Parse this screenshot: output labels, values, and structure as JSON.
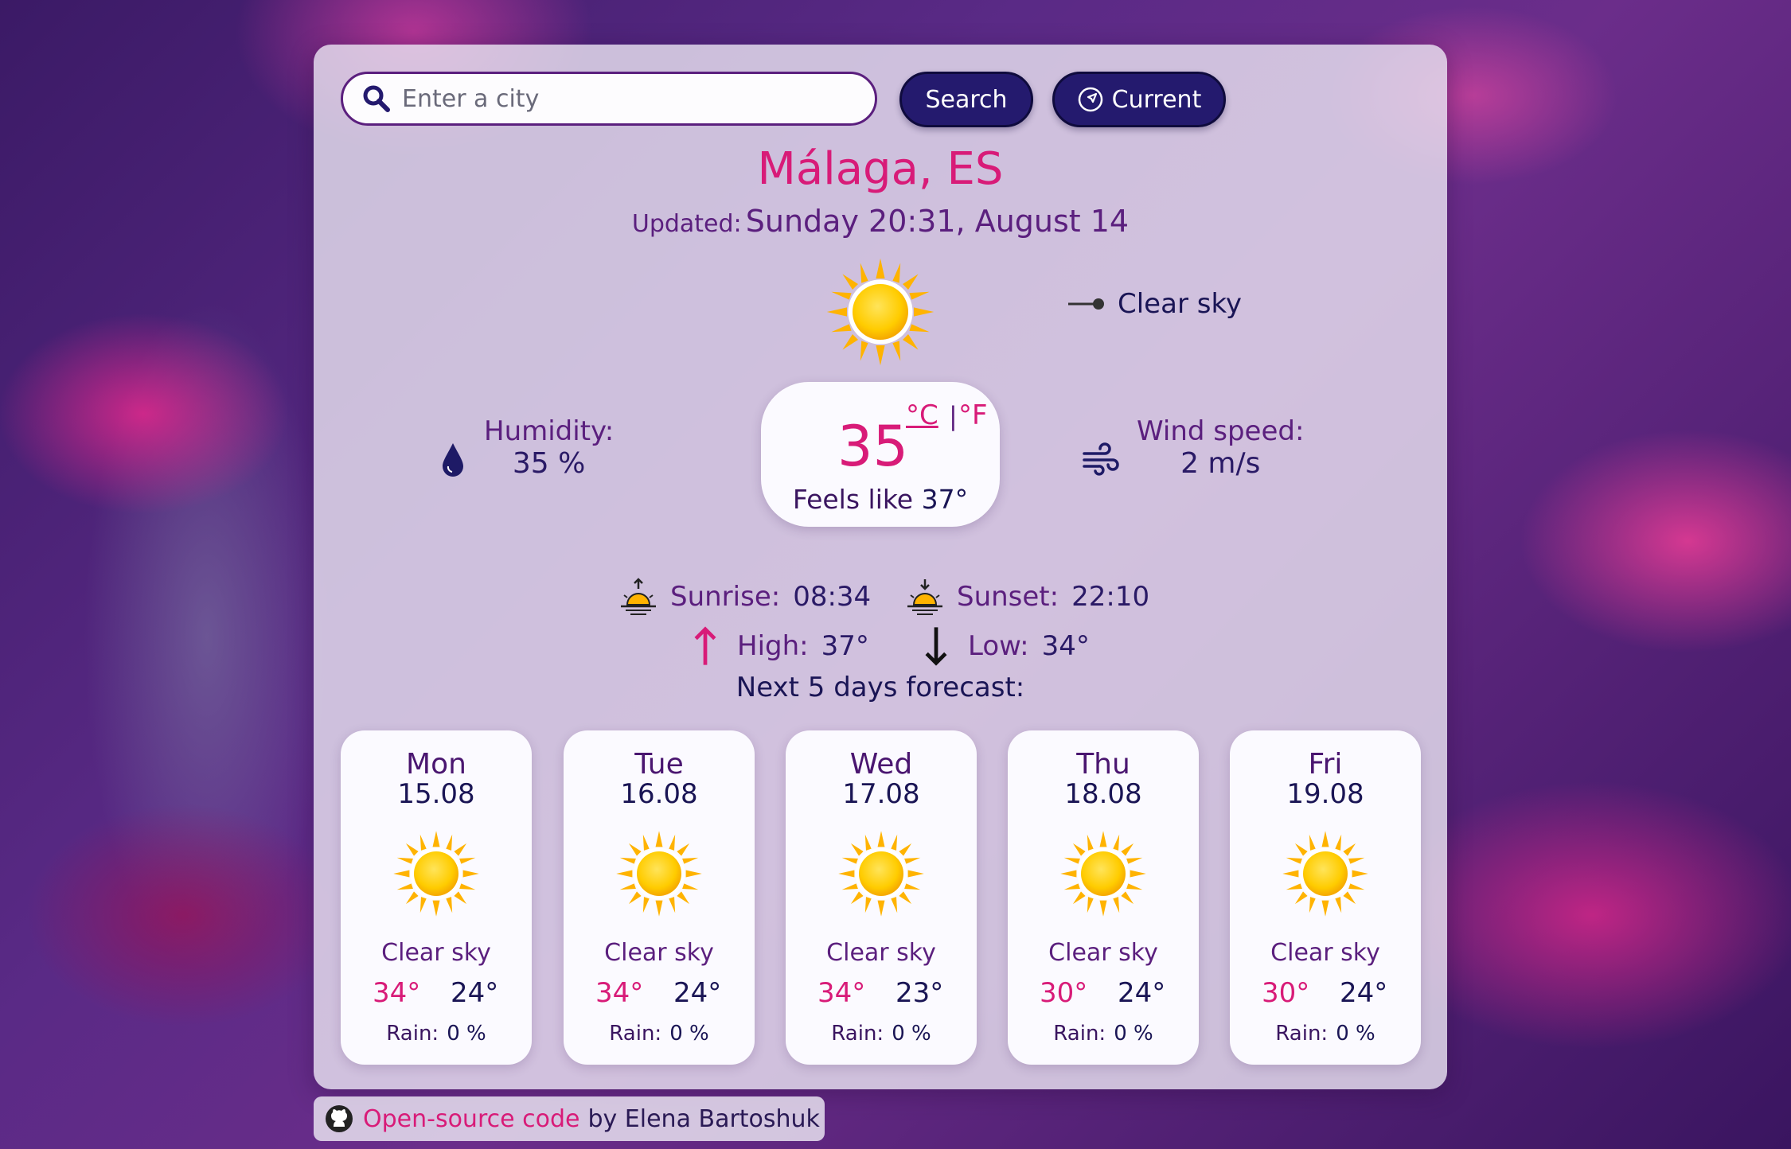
{
  "search": {
    "placeholder": "Enter a city",
    "search_label": "Search",
    "current_label": "Current"
  },
  "city": "Málaga, ES",
  "updated": {
    "label": "Updated:",
    "value": "Sunday 20:31, August 14"
  },
  "condition": {
    "icon": "sun-icon",
    "description": "Clear sky"
  },
  "temperature": {
    "value": "35",
    "celsius": "°C",
    "separator": "|",
    "fahrenheit": "°F",
    "feels_label": "Feels like",
    "feels_value": "37°"
  },
  "humidity": {
    "label": "Humidity:",
    "value": "35 %"
  },
  "wind": {
    "label": "Wind speed:",
    "value": "2 m/s"
  },
  "sun": {
    "sunrise_label": "Sunrise:",
    "sunrise": "08:34",
    "sunset_label": "Sunset:",
    "sunset": "22:10"
  },
  "range": {
    "high_label": "High:",
    "high": "37°",
    "low_label": "Low:",
    "low": "34°"
  },
  "forecast": {
    "title": "Next 5 days forecast:",
    "rain_label": "Rain:",
    "days": [
      {
        "day": "Mon",
        "date": "15.08",
        "desc": "Clear sky",
        "high": "34°",
        "low": "24°",
        "rain": "0 %"
      },
      {
        "day": "Tue",
        "date": "16.08",
        "desc": "Clear sky",
        "high": "34°",
        "low": "24°",
        "rain": "0 %"
      },
      {
        "day": "Wed",
        "date": "17.08",
        "desc": "Clear sky",
        "high": "34°",
        "low": "23°",
        "rain": "0 %"
      },
      {
        "day": "Thu",
        "date": "18.08",
        "desc": "Clear sky",
        "high": "30°",
        "low": "24°",
        "rain": "0 %"
      },
      {
        "day": "Fri",
        "date": "19.08",
        "desc": "Clear sky",
        "high": "30°",
        "low": "24°",
        "rain": "0 %"
      }
    ]
  },
  "footer": {
    "link_text": "Open-source code",
    "author": "by Elena Bartoshuk"
  },
  "colors": {
    "accent": "#d81b78",
    "primary": "#241a6e",
    "text": "#5b1f7e"
  }
}
